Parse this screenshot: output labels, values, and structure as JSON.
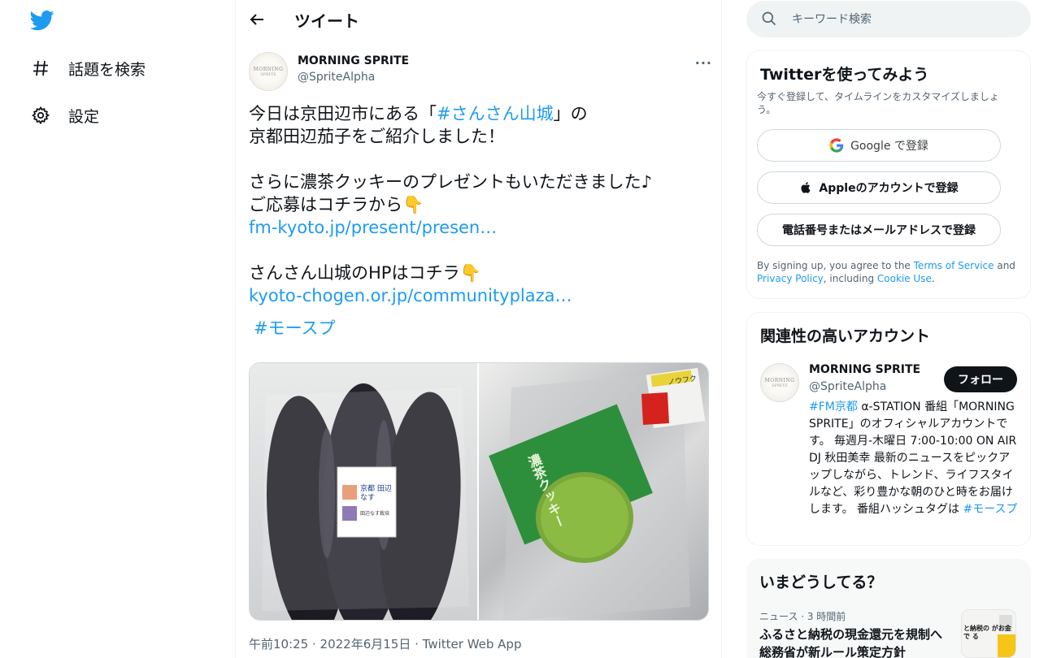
{
  "nav": {
    "items": [
      {
        "label": "話題を検索",
        "icon": "hashtag-icon"
      },
      {
        "label": "設定",
        "icon": "gear-icon"
      }
    ]
  },
  "header": {
    "title": "ツイート"
  },
  "tweet": {
    "author_name": "MORNING SPRITE",
    "author_handle": "@SpriteAlpha",
    "avatar_text_1": "MORNING",
    "avatar_text_2": "SPRITE",
    "more_label": "···",
    "line1_pre": "今日は京田辺市にある「",
    "line1_tag": "#さんさん山城",
    "line1_post": "」の",
    "line2": "京都田辺茄子をご紹介しました！",
    "line3": "さらに濃茶クッキーのプレゼントもいただきました♪",
    "line4": "ご応募はコチラから👇",
    "link1": "fm-kyoto.jp/present/presen…",
    "line5": "さんさん山城のHPはコチラ👇",
    "link2": "kyoto-chogen.or.jp/communityplaza…",
    "hashtag": "#モースプ",
    "timestamp": "午前10:25 · 2022年6月15日 · ",
    "source": "Twitter Web App",
    "photo_left_label": "京都 田辺なす",
    "photo_left_sub": "田辺なす栽培",
    "photo_right_brand": "濃茶クッキー",
    "photo_right_tag": "ノウフク"
  },
  "search": {
    "placeholder": "キーワード検索"
  },
  "signup": {
    "title": "Twitterを使ってみよう",
    "subtitle": "今すぐ登録して、タイムラインをカスタマイズしましょう。",
    "google_label": "Google で登録",
    "apple_label": "Appleのアカウントで登録",
    "phone_label": "電話番号またはメールアドレスで登録",
    "legal_pre": "By signing up, you agree to the ",
    "terms": "Terms of Service",
    "legal_and": " and ",
    "privacy": "Privacy Policy",
    "legal_including": ", including ",
    "cookie": "Cookie Use",
    "legal_end": "."
  },
  "related": {
    "title": "関連性の高いアカウント",
    "name": "MORNING SPRITE",
    "handle": "@SpriteAlpha",
    "follow_label": "フォロー",
    "bio_tag1": "#FM京都",
    "bio_text": " α-STATION 番組「MORNING SPRITE」のオフィシャルアカウントです。 毎週月-木曜日 7:00-10:00 ON AIR DJ 秋田美幸 最新のニュースをピックアップしながら、トレンド、ライフスタイルなど、彩り豊かな朝のひと時をお届けします。 番組ハッシュタグは ",
    "bio_tag2": "#モースプ"
  },
  "trends": {
    "title": "いまどうしてる？",
    "meta": "ニュース · 3 時間前",
    "text": "ふるさと納税の現金還元を規制へ 総務省が新ルール策定方針",
    "thumb_text": "と納税の がお金で る"
  },
  "colors": {
    "accent": "#1d9bf0",
    "text": "#0f1419",
    "secondary": "#536471"
  }
}
